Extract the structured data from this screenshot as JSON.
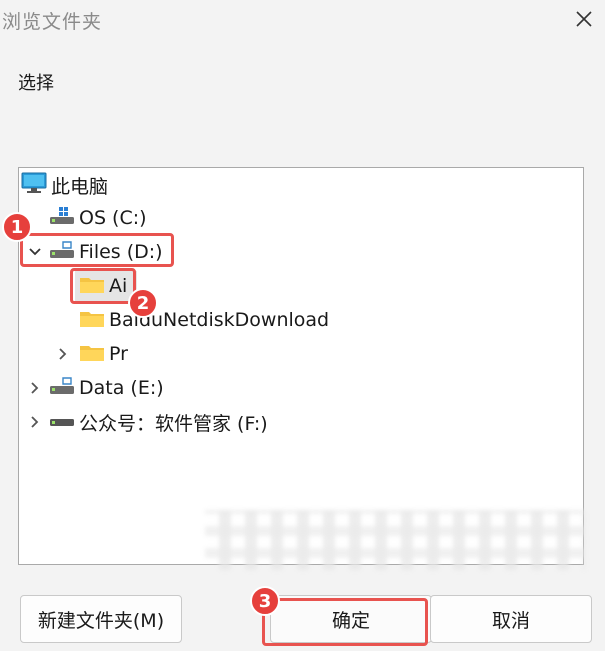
{
  "window": {
    "title": "浏览文件夹"
  },
  "prompt": "选择",
  "tree": {
    "root": "此电脑",
    "items": [
      {
        "label": "OS (C:)"
      },
      {
        "label": "Files (D:)"
      },
      {
        "label": "Ai"
      },
      {
        "label": "BaiduNetdiskDownload"
      },
      {
        "label": "Pr"
      },
      {
        "label": "Data (E:)"
      },
      {
        "label": "公众号：软件管家 (F:)"
      }
    ]
  },
  "badges": [
    "1",
    "2",
    "3"
  ],
  "buttons": {
    "new_folder": "新建文件夹(M)",
    "ok": "确定",
    "cancel": "取消"
  },
  "colors": {
    "highlight": "#e8534f",
    "badge": "#e6403c",
    "folder": "#f5c443"
  }
}
